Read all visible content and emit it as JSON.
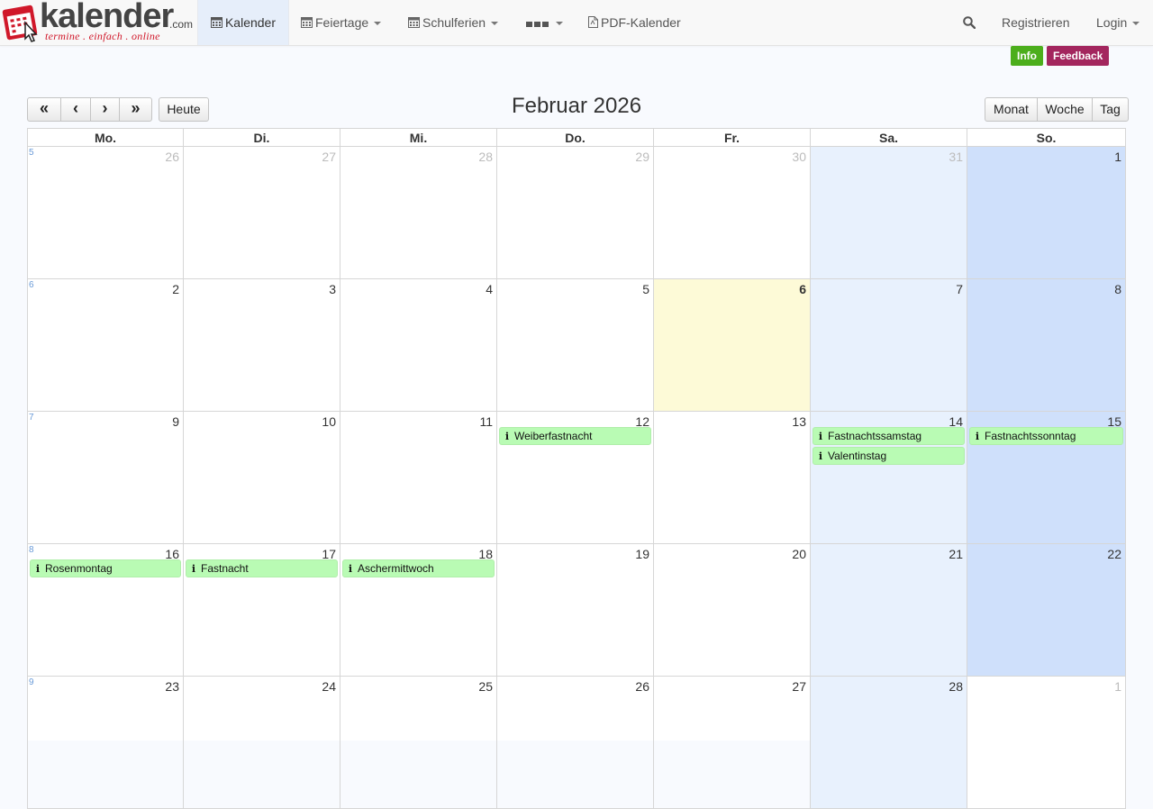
{
  "logo": {
    "word": "kalender",
    "com": ".com",
    "tagline": "termine . einfach . online"
  },
  "nav": {
    "kalender": "Kalender",
    "feiertage": "Feiertage",
    "schulferien": "Schulferien",
    "pdf": "PDF-Kalender",
    "registrieren": "Registrieren",
    "login": "Login"
  },
  "badges": {
    "info": "Info",
    "feedback": "Feedback"
  },
  "toolbar": {
    "prev_year": "«",
    "prev": "‹",
    "next": "›",
    "next_year": "»",
    "today": "Heute",
    "title": "Februar 2026",
    "view_month": "Monat",
    "view_week": "Woche",
    "view_day": "Tag"
  },
  "weekdays": [
    "Mo.",
    "Di.",
    "Mi.",
    "Do.",
    "Fr.",
    "Sa.",
    "So."
  ],
  "weeks": [
    {
      "kw": "5",
      "days": [
        {
          "n": "26",
          "other": true
        },
        {
          "n": "27",
          "other": true
        },
        {
          "n": "28",
          "other": true
        },
        {
          "n": "29",
          "other": true
        },
        {
          "n": "30",
          "other": true
        },
        {
          "n": "31",
          "other": true
        },
        {
          "n": "1"
        }
      ]
    },
    {
      "kw": "6",
      "days": [
        {
          "n": "2"
        },
        {
          "n": "3"
        },
        {
          "n": "4"
        },
        {
          "n": "5"
        },
        {
          "n": "6",
          "today": true
        },
        {
          "n": "7"
        },
        {
          "n": "8"
        }
      ]
    },
    {
      "kw": "7",
      "days": [
        {
          "n": "9"
        },
        {
          "n": "10"
        },
        {
          "n": "11"
        },
        {
          "n": "12",
          "events": [
            "Weiberfastnacht"
          ]
        },
        {
          "n": "13"
        },
        {
          "n": "14",
          "events": [
            "Fastnachtssamstag",
            "Valentinstag"
          ]
        },
        {
          "n": "15",
          "events": [
            "Fastnachtssonntag"
          ]
        }
      ]
    },
    {
      "kw": "8",
      "days": [
        {
          "n": "16",
          "events": [
            "Rosenmontag"
          ]
        },
        {
          "n": "17",
          "events": [
            "Fastnacht"
          ]
        },
        {
          "n": "18",
          "events": [
            "Aschermittwoch"
          ]
        },
        {
          "n": "19"
        },
        {
          "n": "20"
        },
        {
          "n": "21"
        },
        {
          "n": "22"
        }
      ]
    },
    {
      "kw": "9",
      "days": [
        {
          "n": "23"
        },
        {
          "n": "24"
        },
        {
          "n": "25"
        },
        {
          "n": "26"
        },
        {
          "n": "27"
        },
        {
          "n": "28"
        },
        {
          "n": "1",
          "other": true
        }
      ]
    }
  ],
  "colors": {
    "info_badge": "#4cae1c",
    "feedback_badge": "#a3265e",
    "event_bg": "#b9fbb4",
    "saturday": "#e8f1fd",
    "sunday": "#cfe0fb",
    "today": "#fdfad7"
  },
  "icons": {
    "calendar": "calendar-icon",
    "search": "search-icon",
    "pdf": "pdf-file-icon",
    "info": "info-icon",
    "more": "more-dots-icon"
  }
}
